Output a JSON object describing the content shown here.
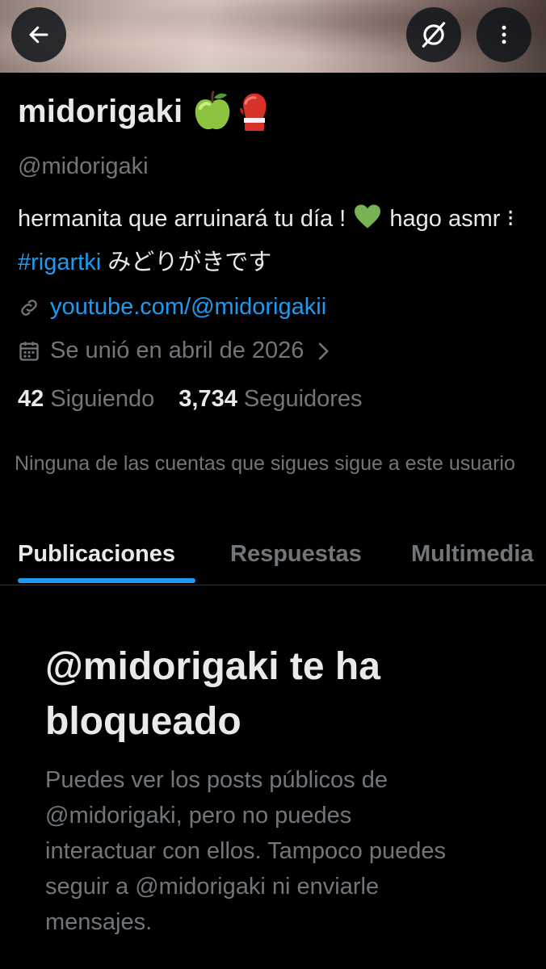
{
  "header": {
    "back_icon": "arrow-left-icon",
    "hide_icon": "eye-slash-icon",
    "more_icon": "more-vertical-icon"
  },
  "profile": {
    "name": "midorigaki",
    "name_emojis": [
      "green-apple",
      "boxing-glove"
    ],
    "handle": "@midorigaki",
    "bio": {
      "part1": "hermanita que arruinará tu día ! ",
      "heart": "green-heart",
      "part2": " hago asmr ⁝ ",
      "hashtag": "#rigartki",
      "part3": " みどりがきです"
    },
    "link": "youtube.com/@midorigakii",
    "joined": "Se unió en abril de 2026",
    "following_count": "42",
    "following_label": "Siguiendo",
    "followers_count": "3,734",
    "followers_label": "Seguidores",
    "followers_you_know": "Ninguna de las cuentas que sigues sigue a este usuario"
  },
  "tabs": [
    {
      "label": "Publicaciones",
      "active": true
    },
    {
      "label": "Respuestas",
      "active": false
    },
    {
      "label": "Multimedia",
      "active": false
    }
  ],
  "blocked": {
    "title": "@midorigaki te ha bloqueado",
    "description": "Puedes ver los posts públicos de @midorigaki, pero no puedes interactuar con ellos. Tampoco puedes seguir a @midorigaki ni enviarle mensajes."
  },
  "colors": {
    "background": "#000000",
    "text_primary": "#e7e9ea",
    "text_secondary": "#71767b",
    "accent": "#1d9bf0"
  }
}
